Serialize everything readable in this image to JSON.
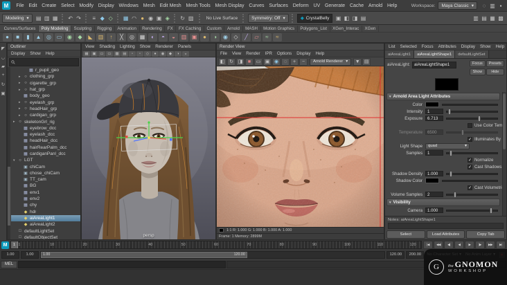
{
  "app": {
    "maya_logo_letter": "M"
  },
  "glyphs": {
    "chevron": "▾",
    "diamond": "◆"
  },
  "menubar": {
    "menus": [
      "File",
      "Edit",
      "Create",
      "Select",
      "Modify",
      "Display",
      "Windows",
      "Mesh",
      "Edit Mesh",
      "Mesh Tools",
      "Mesh Display",
      "Curves",
      "Surfaces",
      "Deform",
      "UV",
      "Generate",
      "Cache",
      "Arnold",
      "Help"
    ],
    "workspace_label": "Workspace:",
    "workspace_value": "Maya Classic",
    "right_icons": [
      "search-icon",
      "workspace-layout-icon",
      "lock-icon"
    ]
  },
  "statusline": {
    "mode_dropdown": "Modeling",
    "icon_groups": [
      [
        "new-scene-icon",
        "open-scene-icon",
        "save-scene-icon"
      ],
      [
        "undo-icon",
        "redo-icon"
      ],
      [
        "select-hierarchy-icon",
        "select-object-icon",
        "select-component-icon"
      ],
      [
        "snap-grid-icon",
        "snap-curve-icon",
        "snap-point-icon",
        "snap-projected-icon",
        "snap-view-icon",
        "make-live-icon"
      ],
      [
        "history-on-icon",
        "construction-history-icon"
      ]
    ],
    "live_surface": "No Live Surface",
    "symmetry": "Symmetry: Off",
    "field_value": "CrystalBelly",
    "render_icons": [
      "open-render-view-icon",
      "render-current-frame-icon",
      "ipr-render-icon",
      "render-settings-icon"
    ],
    "sidebar_icons": [
      "attribute-editor-icon",
      "tool-settings-icon",
      "channel-box-icon",
      "modeling-toolkit-icon"
    ]
  },
  "shelf": {
    "tabs": [
      "Curves/Surfaces",
      "Poly Modeling",
      "Sculpting",
      "Rigging",
      "Animation",
      "Rendering",
      "FX",
      "FX Caching",
      "Custom",
      "Arnold",
      "MASH",
      "Motion Graphics",
      "Polygons_List",
      "XGen_Interac",
      "XGen"
    ],
    "active_tab": "Poly Modeling",
    "icons": [
      {
        "name": "sphere-icon",
        "color": "#9fd0e8"
      },
      {
        "name": "cube-icon",
        "color": "#9fd0e8"
      },
      {
        "name": "cylinder-icon",
        "color": "#9fd0e8"
      },
      {
        "name": "cone-icon",
        "color": "#9fd0e8"
      },
      {
        "name": "torus-icon",
        "color": "#9fd0e8"
      },
      {
        "name": "plane-icon",
        "color": "#9fd0e8"
      },
      {
        "name": "disc-icon",
        "color": "#a6d9a6"
      },
      {
        "name": "platonic-icon",
        "color": "#a6d9a6"
      },
      {
        "name": "bevel-icon",
        "color": "#dcb96e"
      },
      {
        "name": "bridge-icon",
        "color": "#dcb96e"
      },
      {
        "name": "extrude-icon",
        "color": "#dcb96e"
      },
      {
        "name": "multicut-icon",
        "color": "#d6d6d6"
      },
      {
        "name": "target-weld-icon",
        "color": "#d6d6d6"
      },
      {
        "name": "quad-draw-icon",
        "color": "#d6d6d6"
      },
      {
        "name": "mirror-icon",
        "color": "#bfa9e8"
      },
      {
        "name": "smooth-icon",
        "color": "#bfa9e8"
      },
      {
        "name": "boolean-icon",
        "color": "#e89090"
      },
      {
        "name": "separate-icon",
        "color": "#e89090"
      },
      {
        "name": "combine-icon",
        "color": "#e89090"
      },
      {
        "name": "sculpt-icon",
        "color": "#dcb96e"
      },
      {
        "name": "relax-icon",
        "color": "#a6d9a6"
      },
      {
        "name": "grab-icon",
        "color": "#9fd0e8"
      },
      {
        "name": "pinch-icon",
        "color": "#d6d6d6"
      },
      {
        "name": "knife-icon",
        "color": "#bfa9e8"
      },
      {
        "name": "uv-icon",
        "color": "#e89090"
      },
      {
        "name": "xgen-icon",
        "color": "#a6d9a6"
      },
      {
        "name": "groom-icon",
        "color": "#dcb96e"
      }
    ]
  },
  "toolbox_icons": [
    "select-tool-icon",
    "lasso-tool-icon",
    "paint-select-tool-icon",
    "move-tool-icon",
    "rotate-tool-icon",
    "scale-tool-icon"
  ],
  "outliner": {
    "title": "Outliner",
    "menus": [
      "Display",
      "Show",
      "Help"
    ],
    "search_placeholder": "",
    "items": [
      {
        "label": "r_pupil_geo",
        "depth": 2,
        "icon": "mesh"
      },
      {
        "label": "clothing_grp",
        "depth": 1,
        "icon": "group",
        "arrow": "right"
      },
      {
        "label": "cigarette_grp",
        "depth": 1,
        "icon": "group",
        "arrow": "right"
      },
      {
        "label": "hat_grp",
        "depth": 1,
        "icon": "group",
        "arrow": "right"
      },
      {
        "label": "body_geo",
        "depth": 1,
        "icon": "mesh"
      },
      {
        "label": "eyelash_grp",
        "depth": 1,
        "icon": "group",
        "arrow": "right"
      },
      {
        "label": "headHair_grp",
        "depth": 1,
        "icon": "group",
        "arrow": "right"
      },
      {
        "label": "cardigan_grp",
        "depth": 1,
        "icon": "group",
        "arrow": "right"
      },
      {
        "label": "skeletonGrl_rig",
        "depth": 0,
        "icon": "group",
        "arrow": "right"
      },
      {
        "label": "eyebrow_dcc",
        "depth": 1,
        "icon": "mesh"
      },
      {
        "label": "eyelash_dcc",
        "depth": 1,
        "icon": "mesh"
      },
      {
        "label": "headHair_dcc",
        "depth": 1,
        "icon": "mesh"
      },
      {
        "label": "hairRearPalm_dcc",
        "depth": 1,
        "icon": "mesh"
      },
      {
        "label": "cardiganPanl_dcc",
        "depth": 1,
        "icon": "mesh"
      },
      {
        "label": "LGT",
        "depth": 0,
        "icon": "group",
        "arrow": "down"
      },
      {
        "label": "chiCam",
        "depth": 1,
        "icon": "camera"
      },
      {
        "label": "chose_chiCam",
        "depth": 1,
        "icon": "camera"
      },
      {
        "label": "TT_cam",
        "depth": 1,
        "icon": "camera"
      },
      {
        "label": "BG",
        "depth": 1,
        "icon": "mesh"
      },
      {
        "label": "env1",
        "depth": 1,
        "icon": "mesh"
      },
      {
        "label": "env2",
        "depth": 1,
        "icon": "mesh"
      },
      {
        "label": "chy",
        "depth": 1,
        "icon": "mesh"
      },
      {
        "label": "hdr",
        "depth": 1,
        "icon": "light"
      },
      {
        "label": "aiAreaLight1",
        "depth": 1,
        "icon": "light",
        "selected": true
      },
      {
        "label": "aiAreaLight2",
        "depth": 1,
        "icon": "light"
      },
      {
        "label": "defaultLightSet",
        "depth": 0,
        "icon": "set"
      },
      {
        "label": "defaultObjectSet",
        "depth": 0,
        "icon": "set"
      }
    ]
  },
  "viewport": {
    "menus": [
      "View",
      "Shading",
      "Lighting",
      "Show",
      "Renderer",
      "Panels"
    ],
    "toolbar_icons": [
      "grid-icon",
      "camera-lock-icon",
      "film-gate-icon",
      "resolution-gate-icon",
      "gate-mask-icon",
      "field-chart-icon",
      "safe-action-icon",
      "safe-title-icon",
      "wireframe-icon",
      "shaded-icon",
      "textured-icon",
      "lights-icon",
      "shadows-icon",
      "ao-icon"
    ],
    "camera_label": "persp"
  },
  "render_view": {
    "title": "Render View",
    "menus": [
      "File",
      "View",
      "Render",
      "IPR",
      "Options",
      "Display",
      "Help"
    ],
    "toolbar_icons": [
      "render-icon",
      "redo-render-icon",
      "ipr-render-icon",
      "stop-render-icon",
      "region-render-icon",
      "snapshot-icon",
      "rgb-channels-icon",
      "alpha-channel-icon",
      "keep-image-icon",
      "remove-image-icon"
    ],
    "renderer_dropdown": "Arnold Renderer",
    "toolbar_icons_right": [
      "save-image-icon",
      "render-settings-icon"
    ],
    "info_bar": "1:1   R: 1.000  G: 1.000  B: 1.000  A: 1.000",
    "footer": "Frame: 1    Memory: 2899M"
  },
  "attribute_editor": {
    "menus": [
      "List",
      "Selected",
      "Focus",
      "Attributes",
      "Display",
      "Show",
      "Help"
    ],
    "tabs": [
      "aiAreaLight1",
      "aiAreaLightShape1",
      "defaultLightSet"
    ],
    "active_tab_index": 1,
    "node_label": "aiAreaLight:",
    "node_value": "aiAreaLightShape1",
    "header_buttons": [
      "Focus",
      "Presets",
      "Show",
      "Hide"
    ],
    "sections": [
      {
        "title": "Arnold Area Light Attributes",
        "rows": [
          {
            "type": "color",
            "label": "Color",
            "swatch": "#000000"
          },
          {
            "type": "slider",
            "label": "Intensity",
            "value": "1",
            "fill": 0.05
          },
          {
            "type": "slider",
            "label": "Exposure",
            "value": "6.713",
            "fill": 0.65
          },
          {
            "type": "checkbox",
            "label": "Use Color Temperature",
            "checked": false
          },
          {
            "type": "slider",
            "label": "Temperature",
            "value": "6500",
            "fill": 0.32,
            "disabled": true
          },
          {
            "type": "checkbox",
            "label": "Illuminates By Default",
            "checked": true
          },
          {
            "type": "dropdown",
            "label": "Light Shape",
            "value": "quad"
          },
          {
            "type": "slider",
            "label": "Samples",
            "value": "1",
            "fill": 0.08
          },
          {
            "type": "checkbox",
            "label": "Normalize",
            "checked": true
          },
          {
            "type": "checkbox",
            "label": "Cast Shadows",
            "checked": true
          },
          {
            "type": "slider",
            "label": "Shadow Density",
            "value": "1.000",
            "fill": 0.08
          },
          {
            "type": "color",
            "label": "Shadow Color",
            "swatch": "#000000"
          },
          {
            "type": "checkbox",
            "label": "Cast Volumetric Shadows",
            "checked": true
          },
          {
            "type": "slider",
            "label": "Volume Samples",
            "value": "2",
            "fill": 0.16
          }
        ]
      },
      {
        "title": "Visibility",
        "rows": [
          {
            "type": "slider",
            "label": "Camera",
            "value": "1.000",
            "fill": 0.88
          }
        ]
      }
    ],
    "notes_label": "Notes: aiAreaLightShape1",
    "footer_buttons": [
      "Select",
      "Load Attributes",
      "Copy Tab"
    ]
  },
  "timeline": {
    "tick_labels": [
      "1",
      "10",
      "20",
      "30",
      "40",
      "50",
      "60",
      "70",
      "80",
      "90",
      "100",
      "110",
      "120"
    ],
    "current_frame": "1",
    "range": {
      "anim_start": "1.00",
      "play_start": "1.00",
      "play_end": "120.00",
      "anim_end": "200.00"
    },
    "character_set": "No Character Set",
    "anim_layer": "No Anim Layer",
    "transport": [
      {
        "name": "go-to-start-button",
        "glyph": "|◀"
      },
      {
        "name": "step-back-key-button",
        "glyph": "◀◀"
      },
      {
        "name": "step-back-frame-button",
        "glyph": "◀|"
      },
      {
        "name": "play-backwards-button",
        "glyph": "◀"
      },
      {
        "name": "play-forwards-button",
        "glyph": "▶"
      },
      {
        "name": "step-forward-frame-button",
        "glyph": "|▶"
      },
      {
        "name": "step-forward-key-button",
        "glyph": "▶▶"
      },
      {
        "name": "go-to-end-button",
        "glyph": "▶|"
      }
    ]
  },
  "command_line": {
    "label": "MEL",
    "input_value": "",
    "result_value": ""
  },
  "watermark": {
    "the": "the",
    "gnomon": "GNOMON",
    "workshop": "WORKSHOP",
    "g": "G"
  }
}
